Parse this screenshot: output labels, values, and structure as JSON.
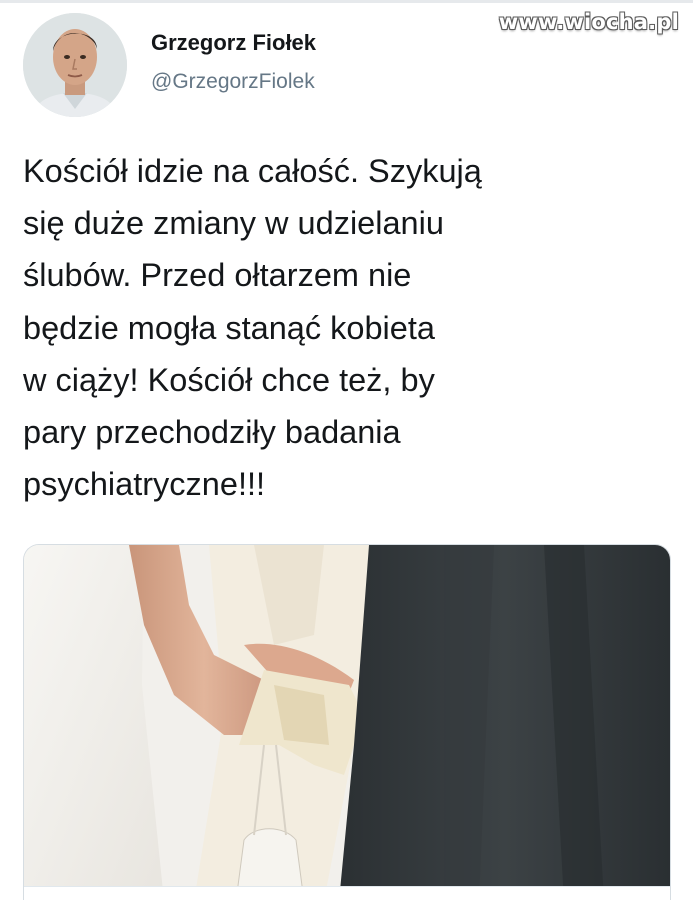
{
  "watermark": {
    "text": "www.wiocha.pl"
  },
  "tweet": {
    "author_name": "Grzegorz Fiołek",
    "author_handle": "@GrzegorzFiolek",
    "text": "Kościół idzie na całość. Szykują się duże zmiany w udzielaniu ślubów. Przed ołtarzem nie będzie mogła stanąć kobieta w ciąży! Kościół chce też, by pary przechodziły badania psychiatryczne!!!",
    "text_lines": [
      "Kościół idzie na całość. Szykują",
      "się duże zmiany w udzielaniu",
      "ślubów. Przed ołtarzem nie",
      "będzie mogła stanąć kobieta",
      "w ciąży! Kościół chce też, by",
      "pary przechodziły badania",
      "psychiatryczne!!!"
    ]
  },
  "media": {
    "icon": "wedding-photo"
  },
  "colors": {
    "name_text": "#14171a",
    "handle_text": "#657786",
    "card_border": "#d6dde2"
  }
}
